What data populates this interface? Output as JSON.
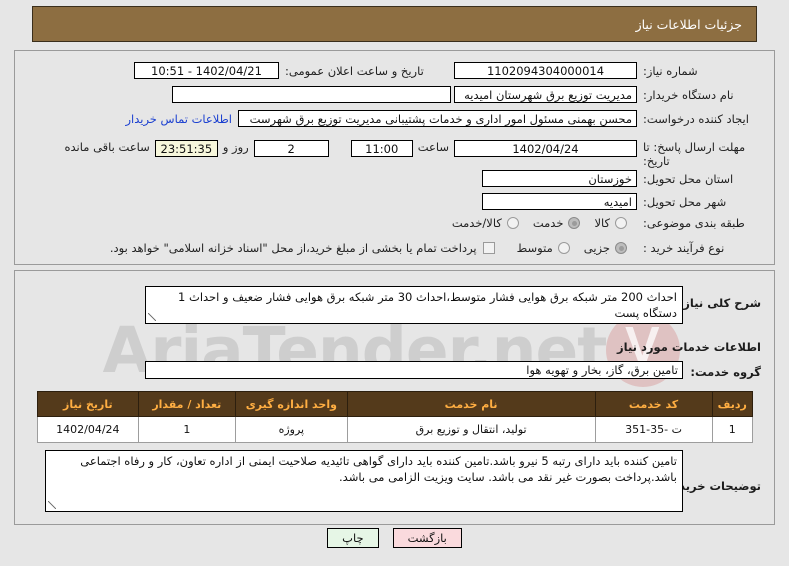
{
  "header": {
    "title": "جزئیات اطلاعات نیاز"
  },
  "colors": {
    "titlebar_bg": "#8d6e41",
    "table_header_bg": "#543a1b",
    "table_header_fg": "#ffae42",
    "link": "#1a3fd0",
    "back_button_bg": "#fadadd",
    "print_button_bg": "#e6f6e6",
    "timer_bg": "#f7f7dc",
    "page_bg": "#e6e6e6"
  },
  "watermark": {
    "text": "AriaTender.net",
    "logo_icon": "tender-drop-logo"
  },
  "form": {
    "need_number_label": "شماره نیاز:",
    "need_number_value": "1102094304000014",
    "announce_datetime_label": "تاریخ و ساعت اعلان عمومی:",
    "announce_datetime_value": "1402/04/21 - 10:51",
    "buyer_org_label": "نام دستگاه خریدار:",
    "buyer_org_value": "مدیریت توزیع برق شهرستان امیدیه",
    "buyer_org_secondary_value": "",
    "requester_label": "ایجاد کننده درخواست:",
    "requester_value": "محسن بهمنی مسئول امور اداری و خدمات پشتیبانی مدیریت توزیع برق شهرست",
    "contact_link_label": "اطلاعات تماس خریدار",
    "deadline_label": "مهلت ارسال پاسخ: تا تاریخ:",
    "deadline_date_value": "1402/04/24",
    "deadline_time_label": "ساعت",
    "deadline_time_value": "11:00",
    "days_value": "2",
    "days_label": "روز و",
    "countdown_value": "23:51:35",
    "countdown_label": "ساعت باقی مانده",
    "province_label": "استان محل تحویل:",
    "province_value": "خوزستان",
    "city_label": "شهر محل تحویل:",
    "city_value": "امیدیه",
    "category_label": "طبقه بندی موضوعی:",
    "category_options": [
      {
        "label": "کالا",
        "selected": false
      },
      {
        "label": "خدمت",
        "selected": true
      },
      {
        "label": "کالا/خدمت",
        "selected": false
      }
    ],
    "process_label": "نوع فرآیند خرید :",
    "process_options": [
      {
        "label": "جزیی",
        "selected": true
      },
      {
        "label": "متوسط",
        "selected": false
      }
    ],
    "treasury_checkbox_checked": false,
    "treasury_note": "پرداخت تمام یا بخشی از مبلغ خرید،از محل \"اسناد خزانه اسلامی\" خواهد بود."
  },
  "description": {
    "label": "شرح کلی نیاز:",
    "value": "احداث 200 متر شبکه برق هوایی فشار متوسط،احداث 30 متر شبکه برق هوایی فشار ضعیف و احداث 1 دستگاه پست"
  },
  "services_section": {
    "heading": "اطلاعات خدمات مورد نیاز",
    "group_label": "گروه خدمت:",
    "group_value": "تامین برق، گاز، بخار و تهویه هوا",
    "table": {
      "columns": [
        "ردیف",
        "کد خدمت",
        "نام خدمت",
        "واحد اندازه گیری",
        "تعداد / مقدار",
        "تاریخ نیاز"
      ],
      "rows": [
        [
          "1",
          "ت -35-351",
          "تولید، انتقال و توزیع برق",
          "پروژه",
          "1",
          "1402/04/24"
        ]
      ]
    }
  },
  "buyer_notes": {
    "label": "توضیحات خریدار:",
    "value": "تامین کننده باید دارای رتبه 5 نیرو باشد.تامین کننده باید دارای گواهی تائیدیه صلاحیت ایمنی از اداره تعاون، کار و رفاه اجتماعی باشد.پرداخت بصورت غیر نقد می باشد. سایت ویزیت الزامی می باشد."
  },
  "buttons": {
    "back_label": "بازگشت",
    "print_label": "چاپ"
  }
}
